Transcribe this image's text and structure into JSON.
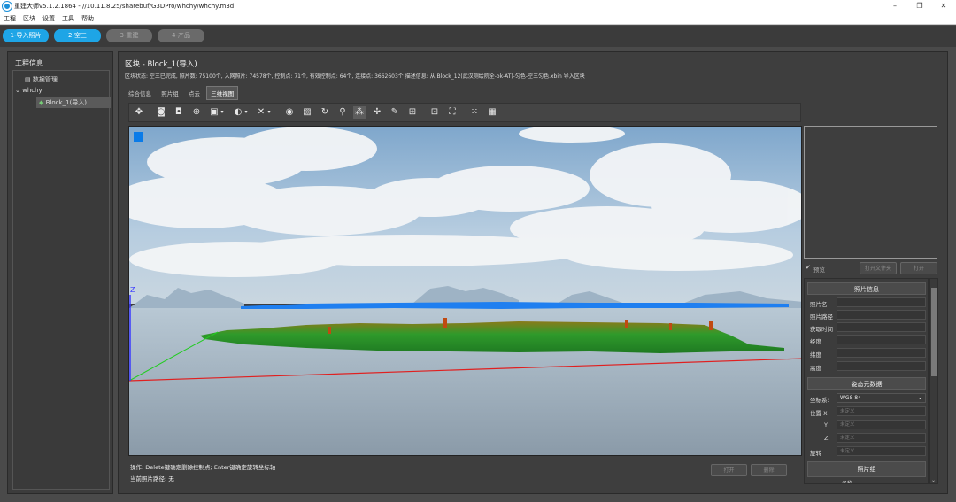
{
  "window": {
    "title": "重建大师v5.1.2.1864 - //10.11.8.25/sharebuf/G3DPro/whchy/whchy.m3d",
    "minimize": "–",
    "restore": "❐",
    "close": "✕"
  },
  "menu": [
    "工程",
    "区块",
    "设置",
    "工具",
    "帮助"
  ],
  "steps": [
    {
      "label": "1-导入照片",
      "state": "active"
    },
    {
      "label": "2-空三",
      "state": "active"
    },
    {
      "label": "3-重建",
      "state": "inactive"
    },
    {
      "label": "4-产品",
      "state": "inactive"
    }
  ],
  "sidebar": {
    "title": "工程信息",
    "tree": {
      "data_manager": "数据管理",
      "project": "whchy",
      "block": "Block_1(导入)"
    }
  },
  "main": {
    "block_title": "区块 - Block_1(导入)",
    "block_status": "区块状态: 空三已完成, 照片数: 75100个, 入网照片: 74578个, 控制点: 71个, 有效控制点: 64个, 连接点: 3662603个 描述信息: 从 Block_12(武汉测绘院全-ok-AT)-匀色-空三匀色.xbin 导入区块",
    "tabs": [
      "综合信息",
      "照片组",
      "点云",
      "三维视图"
    ],
    "active_tab": 3
  },
  "toolbar": {
    "icons": [
      "navigate-icon",
      "camera-add-icon",
      "camera-remove-icon",
      "control-point-icon",
      "photo-select-icon",
      "color-icon",
      "measure-icon",
      "camera-icon",
      "image-icon",
      "rotate-icon",
      "location-pin-icon",
      "point-cloud-icon",
      "pan-icon",
      "brush-icon",
      "ruler-icon",
      "zoom-extent-icon",
      "scatter-icon",
      "photo-icon"
    ]
  },
  "viewport": {
    "axis_z": "Z",
    "colors": {
      "sky_top": "#8fb3d4",
      "cloud": "#f4f6f8",
      "mountain": "#9fb4c6",
      "sea": "#b9c7d2",
      "blue_band": "#1f7ff0",
      "green_cloud": "#2e9a2e",
      "x_axis": "#e02020",
      "y_axis": "#22cc22",
      "z_axis": "#3a3aff"
    }
  },
  "footer": {
    "operation": "操作: Delete键确定删除控制点; Enter键确定旋转坐标轴",
    "current_path": "当前照片路径: 无",
    "open_button": "打开",
    "delete_button": "删除"
  },
  "preview": {
    "checkbox_label": "预览",
    "checked": true,
    "open_folder_button": "打开文件夹",
    "open_button": "打开"
  },
  "photo_info": {
    "header": "照片信息",
    "fields": [
      "照片名",
      "照片路径",
      "获取时间",
      "经度",
      "纬度",
      "高度"
    ]
  },
  "pose_metadata": {
    "header": "姿态元数据",
    "coord_label": "坐标系:",
    "coord_value": "WGS 84",
    "position_label": "位置 X",
    "y_label": "Y",
    "z_label": "Z",
    "rotation_label": "旋转",
    "placeholder": "未定义"
  },
  "photo_group": {
    "header": "照片组",
    "next_label": "名称"
  }
}
